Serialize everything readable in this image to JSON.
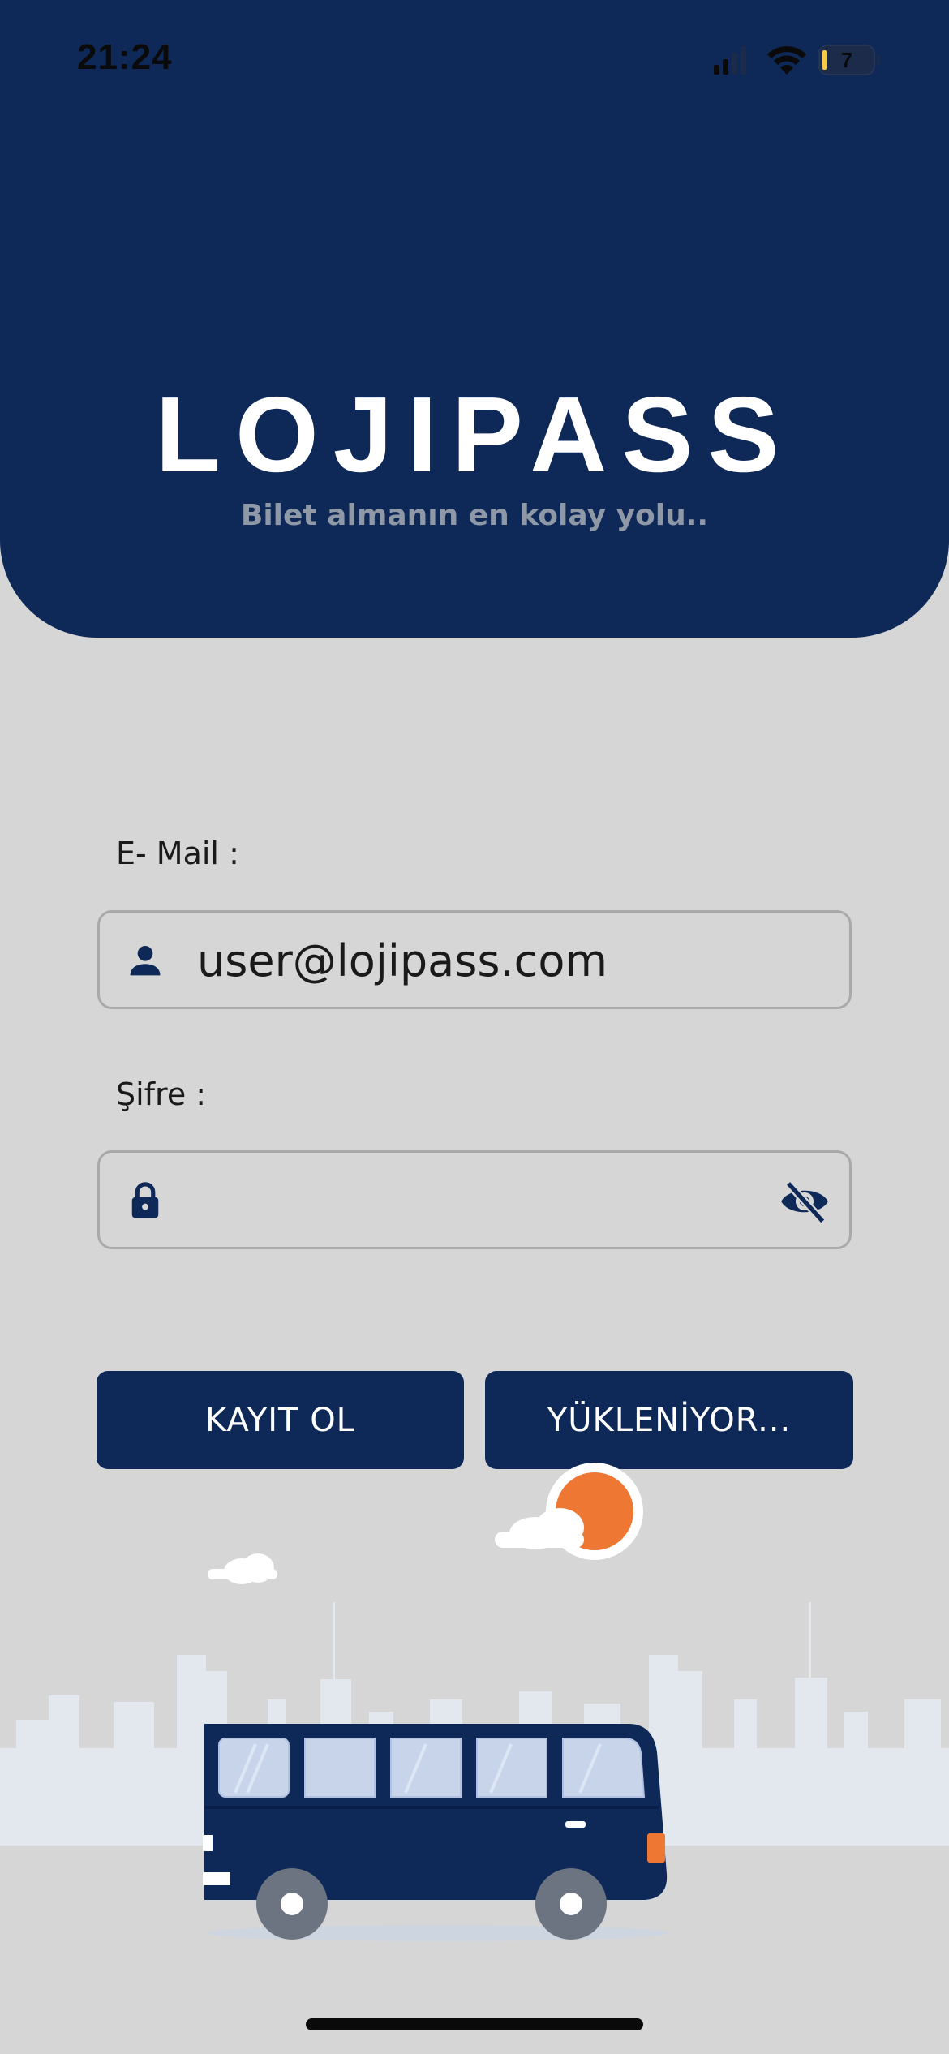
{
  "status_bar": {
    "time": "21:24",
    "battery_level": "7",
    "icons": [
      "cellular-signal-icon",
      "wifi-icon",
      "battery-icon"
    ]
  },
  "header": {
    "brand": "LOJIPASS",
    "tagline": "Bilet almanın en kolay yolu.."
  },
  "form": {
    "email_label": "E- Mail :",
    "email_value": "user@lojipass.com",
    "password_label": "Şifre :",
    "password_value": ""
  },
  "buttons": {
    "register": "KAYIT OL",
    "login_loading": "YÜKLENİYOR..."
  },
  "colors": {
    "primary": "#0e2857",
    "background": "#d6d6d6",
    "accent_sun": "#ee7733",
    "city": "#e3e7ee"
  }
}
